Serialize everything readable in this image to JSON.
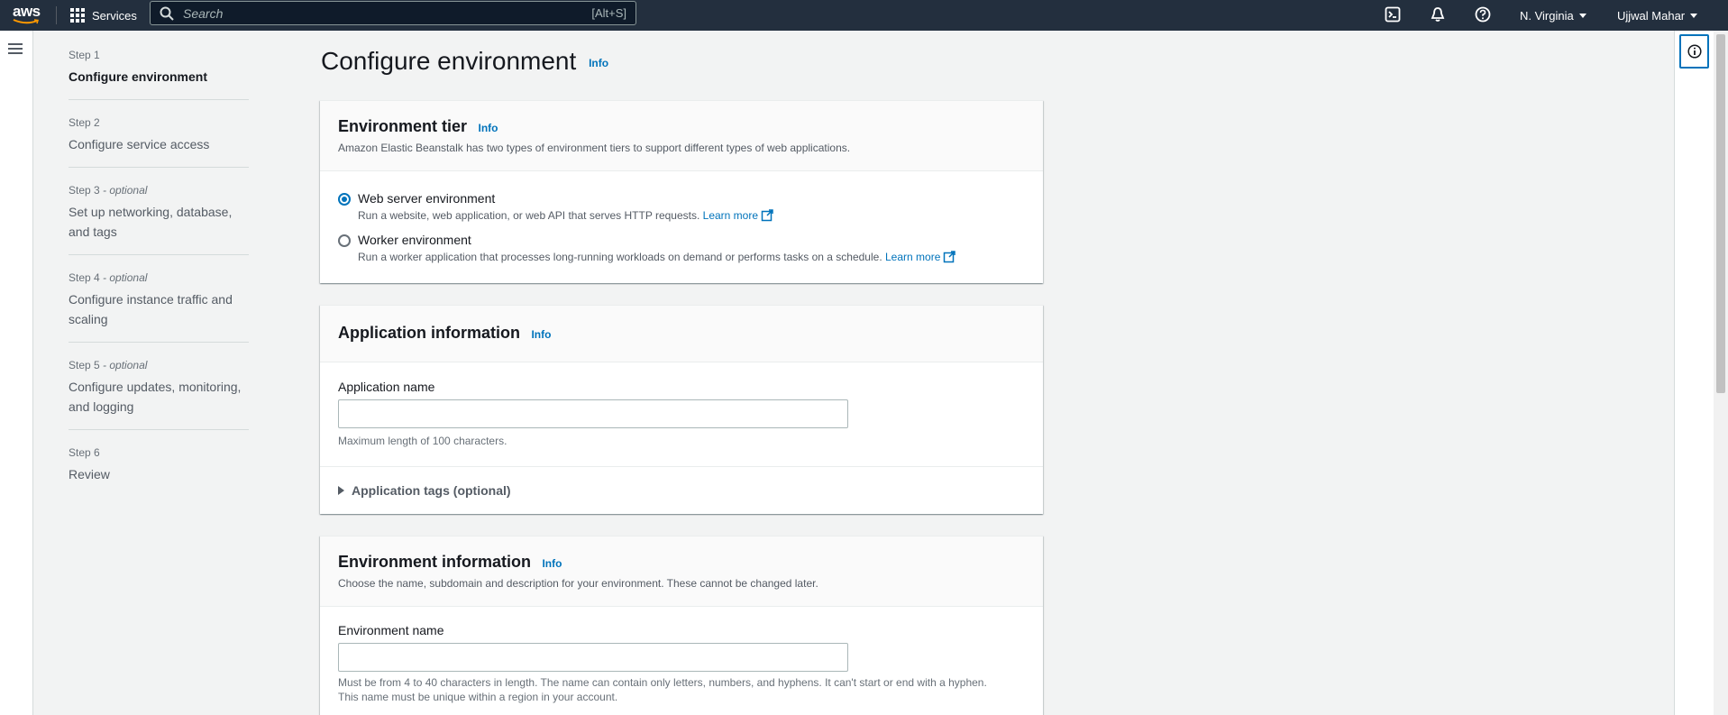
{
  "topnav": {
    "logo": "aws",
    "services_label": "Services",
    "search_placeholder": "Search",
    "search_shortcut": "[Alt+S]",
    "region": "N. Virginia",
    "user": "Ujjwal Mahar",
    "icons": [
      "cloudshell-icon",
      "bell-icon",
      "help-icon"
    ]
  },
  "steps": [
    {
      "num": "Step 1",
      "optional": "",
      "title": "Configure environment",
      "active": true
    },
    {
      "num": "Step 2",
      "optional": "",
      "title": "Configure service access",
      "active": false
    },
    {
      "num": "Step 3",
      "optional": " - optional",
      "title": "Set up networking, database, and tags",
      "active": false
    },
    {
      "num": "Step 4",
      "optional": " - optional",
      "title": "Configure instance traffic and scaling",
      "active": false
    },
    {
      "num": "Step 5",
      "optional": " - optional",
      "title": "Configure updates, monitoring, and logging",
      "active": false
    },
    {
      "num": "Step 6",
      "optional": "",
      "title": "Review",
      "active": false
    }
  ],
  "page": {
    "title": "Configure environment",
    "info": "Info"
  },
  "env_tier": {
    "title": "Environment tier",
    "info": "Info",
    "description": "Amazon Elastic Beanstalk has two types of environment tiers to support different types of web applications.",
    "options": [
      {
        "label": "Web server environment",
        "desc": "Run a website, web application, or web API that serves HTTP requests.",
        "learn": "Learn more",
        "checked": true
      },
      {
        "label": "Worker environment",
        "desc": "Run a worker application that processes long-running workloads on demand or performs tasks on a schedule.",
        "learn": "Learn more",
        "checked": false
      }
    ]
  },
  "app_info": {
    "title": "Application information",
    "info": "Info",
    "name_label": "Application name",
    "name_value": "",
    "name_hint": "Maximum length of 100 characters.",
    "tags_label": "Application tags (optional)"
  },
  "env_info": {
    "title": "Environment information",
    "info": "Info",
    "description": "Choose the name, subdomain and description for your environment. These cannot be changed later.",
    "name_label": "Environment name",
    "name_value": "",
    "name_hint_1": "Must be from 4 to 40 characters in length. The name can contain only letters, numbers, and hyphens. It can't start or end with a hyphen.",
    "name_hint_2": "This name must be unique within a region in your account."
  },
  "colors": {
    "nav_bg": "#232f3e",
    "link": "#0073bb",
    "page_bg": "#f2f3f3"
  }
}
